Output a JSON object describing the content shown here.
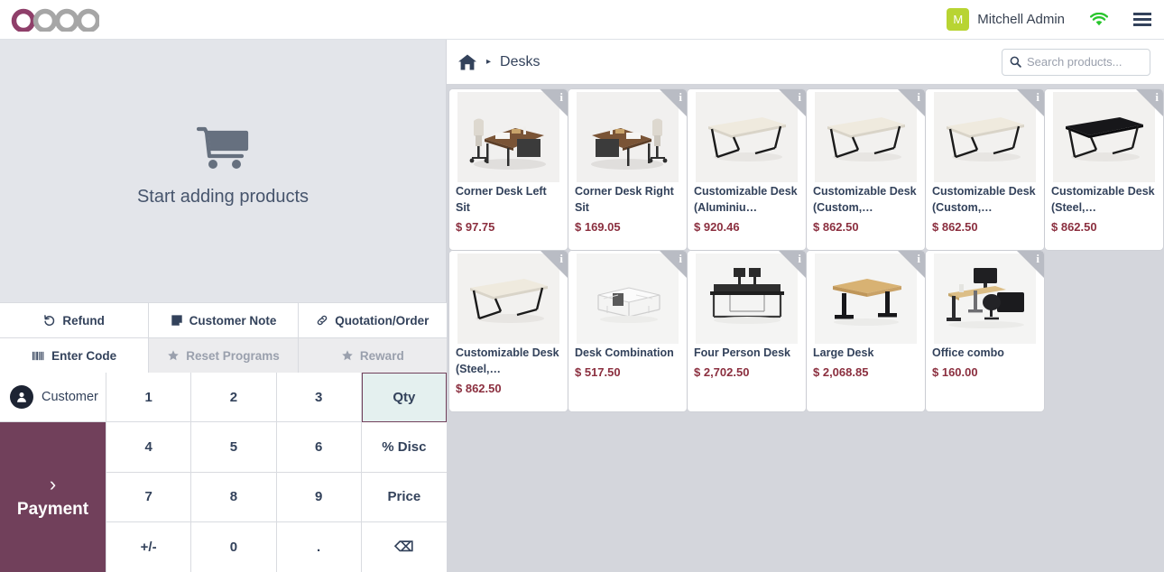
{
  "navbar": {
    "logo_text": "odoo",
    "user_initial": "M",
    "user_name": "Mitchell Admin",
    "wifi_icon": "wifi-icon",
    "menu_icon": "hamburger-menu-icon",
    "avatar_color": "#b8d432"
  },
  "order_panel": {
    "empty_icon": "shopping-cart-icon",
    "empty_text": "Start adding products",
    "background": "#e3e5ea"
  },
  "action_buttons": {
    "row1": [
      {
        "label": "Refund",
        "icon": "refund-undo-icon",
        "disabled": false
      },
      {
        "label": "Customer Note",
        "icon": "note-icon",
        "disabled": false
      },
      {
        "label": "Quotation/Order",
        "icon": "link-chain-icon",
        "disabled": false
      }
    ],
    "row2": [
      {
        "label": "Enter Code",
        "icon": "barcode-icon",
        "disabled": false
      },
      {
        "label": "Reset Programs",
        "icon": "star-icon",
        "disabled": true
      },
      {
        "label": "Reward",
        "icon": "star-icon",
        "disabled": true
      }
    ]
  },
  "customer": {
    "label": "Customer",
    "icon": "user-avatar-icon"
  },
  "payment": {
    "label": "Payment",
    "chevron": "›",
    "color": "#71405b"
  },
  "numpad": {
    "keys": [
      {
        "label": "1",
        "selected": false
      },
      {
        "label": "2",
        "selected": false
      },
      {
        "label": "3",
        "selected": false
      },
      {
        "label": "Qty",
        "selected": true
      },
      {
        "label": "4",
        "selected": false
      },
      {
        "label": "5",
        "selected": false
      },
      {
        "label": "6",
        "selected": false
      },
      {
        "label": "% Disc",
        "selected": false
      },
      {
        "label": "7",
        "selected": false
      },
      {
        "label": "8",
        "selected": false
      },
      {
        "label": "9",
        "selected": false
      },
      {
        "label": "Price",
        "selected": false
      },
      {
        "label": "+/-",
        "selected": false
      },
      {
        "label": "0",
        "selected": false
      },
      {
        "label": ".",
        "selected": false
      },
      {
        "label": "⌫",
        "selected": false
      }
    ],
    "selected_bg": "#e4f0ef",
    "selected_border": "#71405b"
  },
  "product_header": {
    "home_icon": "home-icon",
    "separator": "▸",
    "category": "Desks",
    "search_icon": "search-icon",
    "search_placeholder": "Search products...",
    "search_value": ""
  },
  "products": [
    {
      "name": "Corner Desk Left Sit",
      "price": "$ 97.75",
      "image": "corner-desk-left-photo",
      "info_badge": "info-icon"
    },
    {
      "name": "Corner Desk Right Sit",
      "price": "$ 169.05",
      "image": "corner-desk-right-photo",
      "info_badge": "info-icon"
    },
    {
      "name": "Customizable Desk (Aluminiu…",
      "price": "$ 920.46",
      "image": "customizable-desk-white-photo",
      "info_badge": "info-icon"
    },
    {
      "name": "Customizable Desk (Custom,…",
      "price": "$ 862.50",
      "image": "customizable-desk-white-photo",
      "info_badge": "info-icon"
    },
    {
      "name": "Customizable Desk (Custom,…",
      "price": "$ 862.50",
      "image": "customizable-desk-white-photo",
      "info_badge": "info-icon"
    },
    {
      "name": "Customizable Desk (Steel,…",
      "price": "$ 862.50",
      "image": "customizable-desk-black-photo",
      "info_badge": "info-icon"
    },
    {
      "name": "Customizable Desk (Steel,…",
      "price": "$ 862.50",
      "image": "customizable-desk-white-photo",
      "info_badge": "info-icon"
    },
    {
      "name": "Desk Combination",
      "price": "$ 517.50",
      "image": "desk-combination-photo",
      "info_badge": "info-icon"
    },
    {
      "name": "Four Person Desk",
      "price": "$ 2,702.50",
      "image": "four-person-desk-photo",
      "info_badge": "info-icon"
    },
    {
      "name": "Large Desk",
      "price": "$ 2,068.85",
      "image": "large-desk-photo",
      "info_badge": "info-icon"
    },
    {
      "name": "Office combo",
      "price": "$ 160.00",
      "image": "office-combo-photo",
      "info_badge": "info-icon"
    }
  ],
  "colors": {
    "odoo_purple": "#71405b",
    "price_red": "#8b2f3f",
    "text_navy": "#33425b",
    "panel_bg": "#e3e5ea",
    "grid_bg": "#d4d6dc"
  }
}
